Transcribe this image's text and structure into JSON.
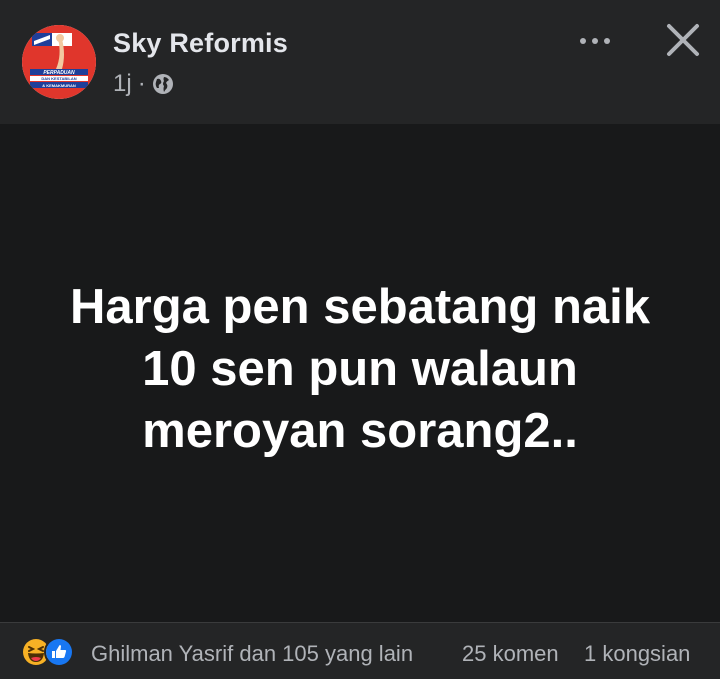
{
  "header": {
    "page_name": "Sky Reformis",
    "time_ago": "1j",
    "separator": "·",
    "privacy_icon": "globe-icon",
    "more_icon": "more-options-icon",
    "close_icon": "close-icon"
  },
  "avatar": {
    "logo_lines": [
      "PERPADUAN",
      "DAN KESTABILAN",
      "& KEMAKMURAN"
    ]
  },
  "post": {
    "lines": [
      "Harga pen sebatang naik",
      "10 sen pun walaun",
      "meroyan sorang2.."
    ],
    "background_color": "#18191a",
    "text_color": "#ffffff"
  },
  "footer": {
    "reaction_icons": [
      "haha-reaction-icon",
      "like-reaction-icon"
    ],
    "reactors": "Ghilman Yasrif dan 105 yang lain",
    "comments": "25 komen",
    "shares": "1 kongsian"
  },
  "colors": {
    "surface": "#242526",
    "secondary_text": "#b0b3b8",
    "like_blue": "#1877f2",
    "haha_yellow": "#f7b125"
  }
}
